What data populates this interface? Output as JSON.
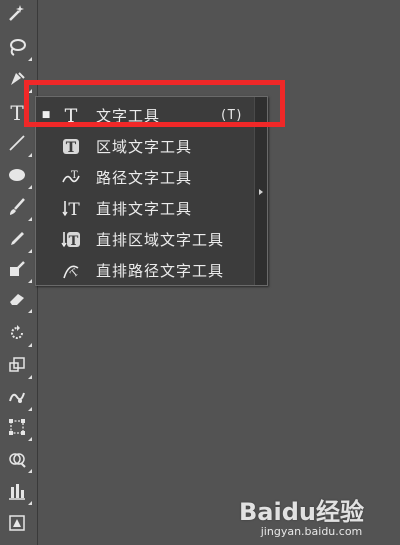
{
  "toolbar": {
    "tools": [
      {
        "name": "magic-wand-tool",
        "icon": "magic-wand-icon"
      },
      {
        "name": "lasso-tool",
        "icon": "lasso-icon"
      },
      {
        "name": "pen-tool",
        "icon": "pen-icon"
      },
      {
        "name": "type-tool",
        "icon": "type-t-icon",
        "glyph": "T"
      },
      {
        "name": "line-segment-tool",
        "icon": "line-icon"
      },
      {
        "name": "ellipse-tool",
        "icon": "ellipse-icon"
      },
      {
        "name": "paintbrush-tool",
        "icon": "brush-icon"
      },
      {
        "name": "pencil-tool",
        "icon": "pencil-icon"
      },
      {
        "name": "shaper-tool",
        "icon": "shaper-icon"
      },
      {
        "name": "eraser-tool",
        "icon": "eraser-icon"
      },
      {
        "name": "rotate-tool",
        "icon": "rotate-icon"
      },
      {
        "name": "scale-tool",
        "icon": "scale-icon"
      },
      {
        "name": "warp-tool",
        "icon": "warp-icon"
      },
      {
        "name": "free-transform-tool",
        "icon": "free-transform-icon"
      },
      {
        "name": "shape-builder-tool",
        "icon": "shape-builder-icon"
      },
      {
        "name": "graph-tool",
        "icon": "graph-icon"
      },
      {
        "name": "symbol-sprayer-tool",
        "icon": "symbol-icon"
      }
    ]
  },
  "flyout": {
    "items": [
      {
        "label": "文字工具",
        "shortcut": "(T)",
        "selected": true,
        "icon": "type-icon"
      },
      {
        "label": "区域文字工具",
        "shortcut": "",
        "selected": false,
        "icon": "area-type-icon"
      },
      {
        "label": "路径文字工具",
        "shortcut": "",
        "selected": false,
        "icon": "type-on-path-icon"
      },
      {
        "label": "直排文字工具",
        "shortcut": "",
        "selected": false,
        "icon": "vertical-type-icon"
      },
      {
        "label": "直排区域文字工具",
        "shortcut": "",
        "selected": false,
        "icon": "vertical-area-type-icon"
      },
      {
        "label": "直排路径文字工具",
        "shortcut": "",
        "selected": false,
        "icon": "vertical-type-on-path-icon"
      }
    ],
    "check_mark": "■"
  },
  "watermark": {
    "logo": "Bai 经验",
    "logo_full": "Baidu经验",
    "sub": "jingyan.baidu.com"
  },
  "colors": {
    "background": "#535353",
    "flyout": "#3c3c3c",
    "highlight": "#f02828"
  }
}
